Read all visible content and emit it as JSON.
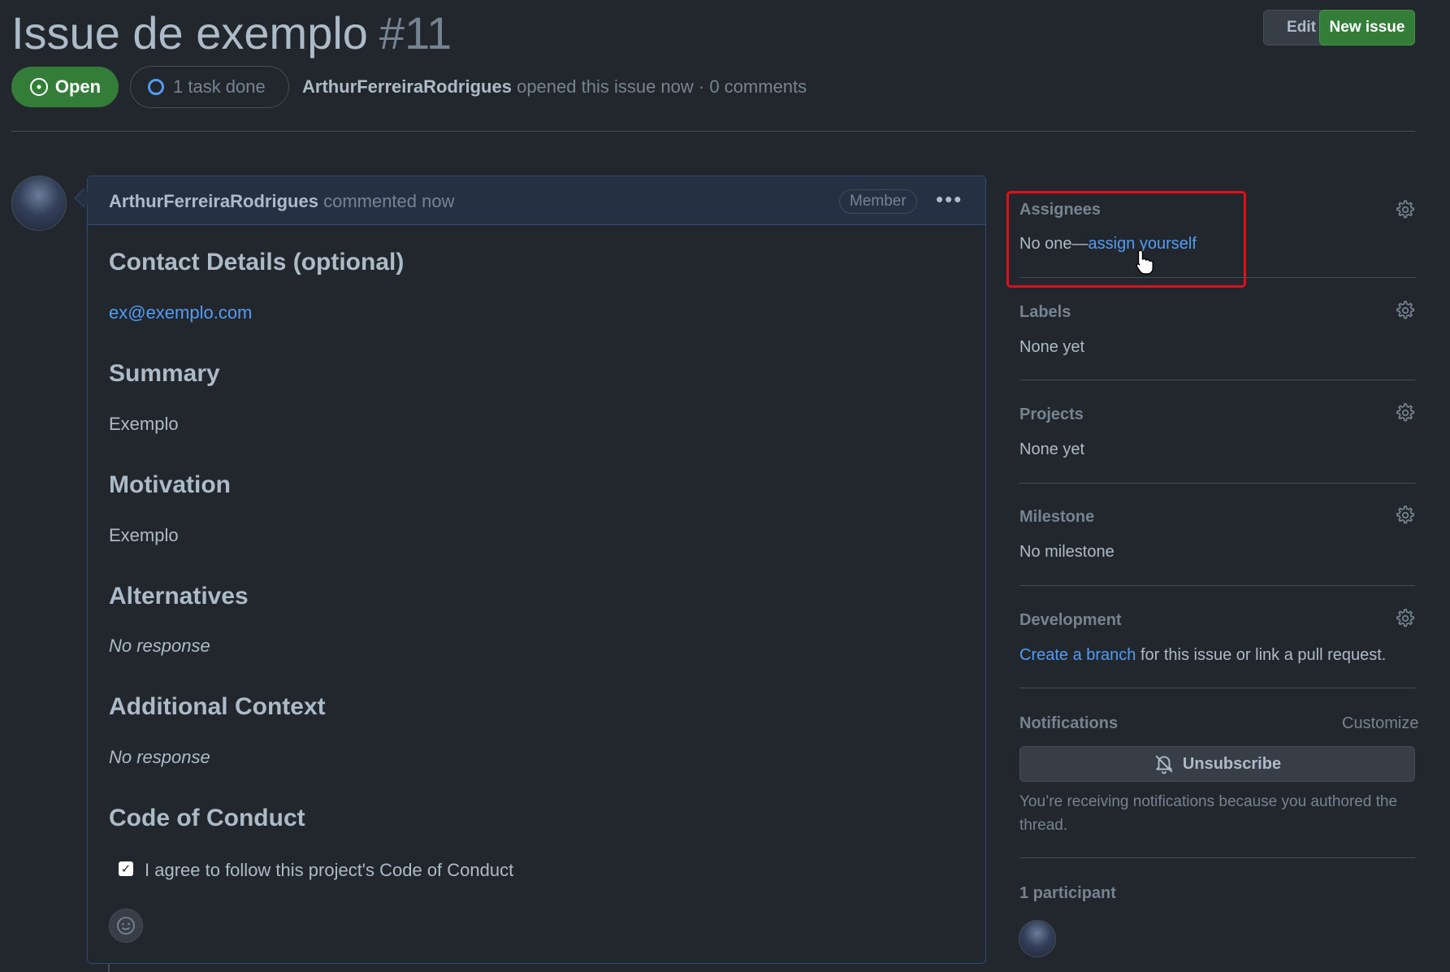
{
  "header": {
    "title": "Issue de exemplo",
    "number": "#11",
    "edit_label": "Edit",
    "new_issue_label": "New issue",
    "state": "Open",
    "tasks": "1 task done",
    "author": "ArthurFerreiraRodrigues",
    "meta_rest": "opened this issue now · 0 comments"
  },
  "comment": {
    "author": "ArthurFerreiraRodrigues",
    "action": "commented now",
    "role_badge": "Member",
    "more_icon": "kebab-horizontal-icon",
    "sections": {
      "contact_heading": "Contact Details (optional)",
      "contact_value": "ex@exemplo.com",
      "summary_heading": "Summary",
      "summary_value": "Exemplo",
      "motivation_heading": "Motivation",
      "motivation_value": "Exemplo",
      "alternatives_heading": "Alternatives",
      "alternatives_value": "No response",
      "context_heading": "Additional Context",
      "context_value": "No response",
      "conduct_heading": "Code of Conduct",
      "conduct_checkbox": "I agree to follow this project's Code of Conduct"
    },
    "conduct_checked": true
  },
  "sidebar": {
    "assignees_label": "Assignees",
    "assignees_value_prefix": "No one—",
    "assignees_link": "assign yourself",
    "labels_label": "Labels",
    "labels_value": "None yet",
    "projects_label": "Projects",
    "projects_value": "None yet",
    "milestone_label": "Milestone",
    "milestone_value": "No milestone",
    "development_label": "Development",
    "development_link": "Create a branch",
    "development_rest": " for this issue or link a pull request.",
    "notifications_label": "Notifications",
    "customize_label": "Customize",
    "unsubscribe_label": "Unsubscribe",
    "notifications_text": "You’re receiving notifications because you authored the thread.",
    "participants_label": "1 participant"
  },
  "colors": {
    "background": "#22272e",
    "open_green": "#347d39",
    "link_blue": "#539bf5",
    "highlight_red": "#e0101a"
  }
}
